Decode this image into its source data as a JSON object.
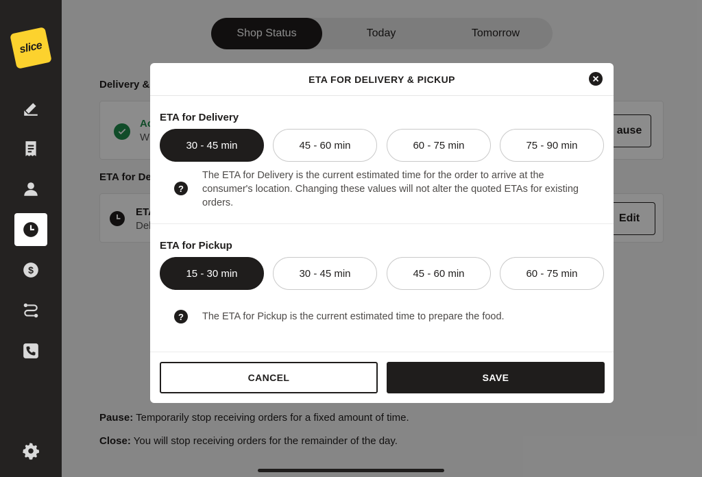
{
  "sidebar": {
    "logo_text": "slice",
    "items": [
      {
        "icon": "pencil-icon"
      },
      {
        "icon": "receipt-icon"
      },
      {
        "icon": "person-icon"
      },
      {
        "icon": "clock-icon",
        "active": true
      },
      {
        "icon": "dollar-icon"
      },
      {
        "icon": "route-icon"
      },
      {
        "icon": "phone-icon"
      }
    ],
    "settings_icon": "gear-icon"
  },
  "tabs": [
    {
      "label": "Shop Status",
      "active": true
    },
    {
      "label": "Today"
    },
    {
      "label": "Tomorrow"
    }
  ],
  "background": {
    "section1_heading": "Delivery &",
    "status_title": "Ac",
    "status_sub": "W",
    "pause_button": "ause",
    "section2_heading": "ETA for De",
    "eta_title": "ETA",
    "eta_sub": "Del",
    "edit_button": "Edit",
    "pause_label": "Pause:",
    "pause_desc": "Temporarily stop receiving orders for a fixed amount of time.",
    "close_label": "Close:",
    "close_desc": "You will stop receiving orders for the remainder of the day."
  },
  "modal": {
    "title": "ETA FOR DELIVERY & PICKUP",
    "delivery": {
      "label": "ETA for Delivery",
      "options": [
        "30 - 45 min",
        "45 - 60 min",
        "60 - 75 min",
        "75 - 90 min"
      ],
      "selected": "30 - 45 min",
      "help": "The ETA for Delivery is the current estimated time for the order to arrive at the consumer's location. Changing these values will not alter the quoted ETAs for existing orders."
    },
    "pickup": {
      "label": "ETA for Pickup",
      "options": [
        "15 - 30 min",
        "30 - 45 min",
        "45 - 60 min",
        "60 - 75 min"
      ],
      "selected": "15 - 30 min",
      "help": "The ETA for Pickup is the current estimated time to prepare the food."
    },
    "help_glyph": "?",
    "cancel_label": "CANCEL",
    "save_label": "SAVE"
  },
  "colors": {
    "brand_yellow": "#fcd22e",
    "dark": "#1f1d1c",
    "success": "#1e8a4c"
  }
}
